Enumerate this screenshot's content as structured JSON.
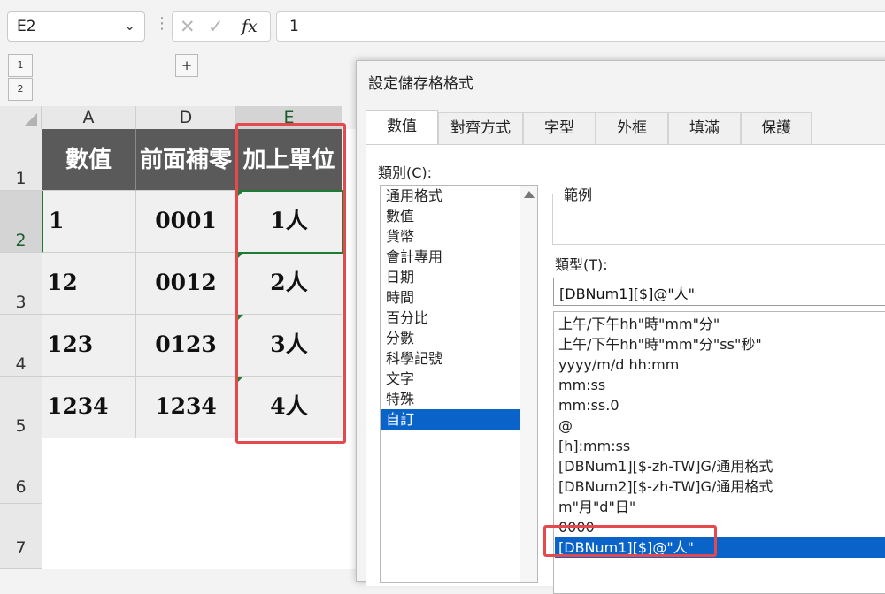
{
  "formula_bar": {
    "name_box": "E2",
    "formula": "1"
  },
  "outline": {
    "levels": [
      "1",
      "2"
    ],
    "expand": "+"
  },
  "columns": [
    "A",
    "D",
    "E"
  ],
  "rows": [
    "1",
    "2",
    "3",
    "4",
    "5",
    "6",
    "7"
  ],
  "table": {
    "headers": [
      "數值",
      "前面補零",
      "加上單位"
    ],
    "rows": [
      [
        "1",
        "0001",
        "1人"
      ],
      [
        "12",
        "0012",
        "2人"
      ],
      [
        "123",
        "0123",
        "3人"
      ],
      [
        "1234",
        "1234",
        "4人"
      ]
    ]
  },
  "dialog": {
    "title": "設定儲存格格式",
    "tabs": [
      "數值",
      "對齊方式",
      "字型",
      "外框",
      "填滿",
      "保護"
    ],
    "category_label": "類別(C):",
    "categories": [
      "通用格式",
      "數值",
      "貨幣",
      "會計專用",
      "日期",
      "時間",
      "百分比",
      "分數",
      "科學記號",
      "文字",
      "特殊",
      "自訂"
    ],
    "selected_category": "自訂",
    "sample_label": "範例",
    "type_label": "類型(T):",
    "type_value": "[DBNum1][$]@\"人\"",
    "formats": [
      "上午/下午hh\"時\"mm\"分\"",
      "上午/下午hh\"時\"mm\"分\"ss\"秒\"",
      "yyyy/m/d hh:mm",
      "mm:ss",
      "mm:ss.0",
      "@",
      "[h]:mm:ss",
      "[DBNum1][$-zh-TW]G/通用格式",
      "[DBNum2][$-zh-TW]G/通用格式",
      "m\"月\"d\"日\"",
      "0000",
      "[DBNum1][$]@\"人\""
    ]
  },
  "colors": {
    "header_fill": "#5a5a5a",
    "selection_blue": "#0a63c9",
    "highlight_red": "#e5484d",
    "active_green": "#1e7b34"
  }
}
